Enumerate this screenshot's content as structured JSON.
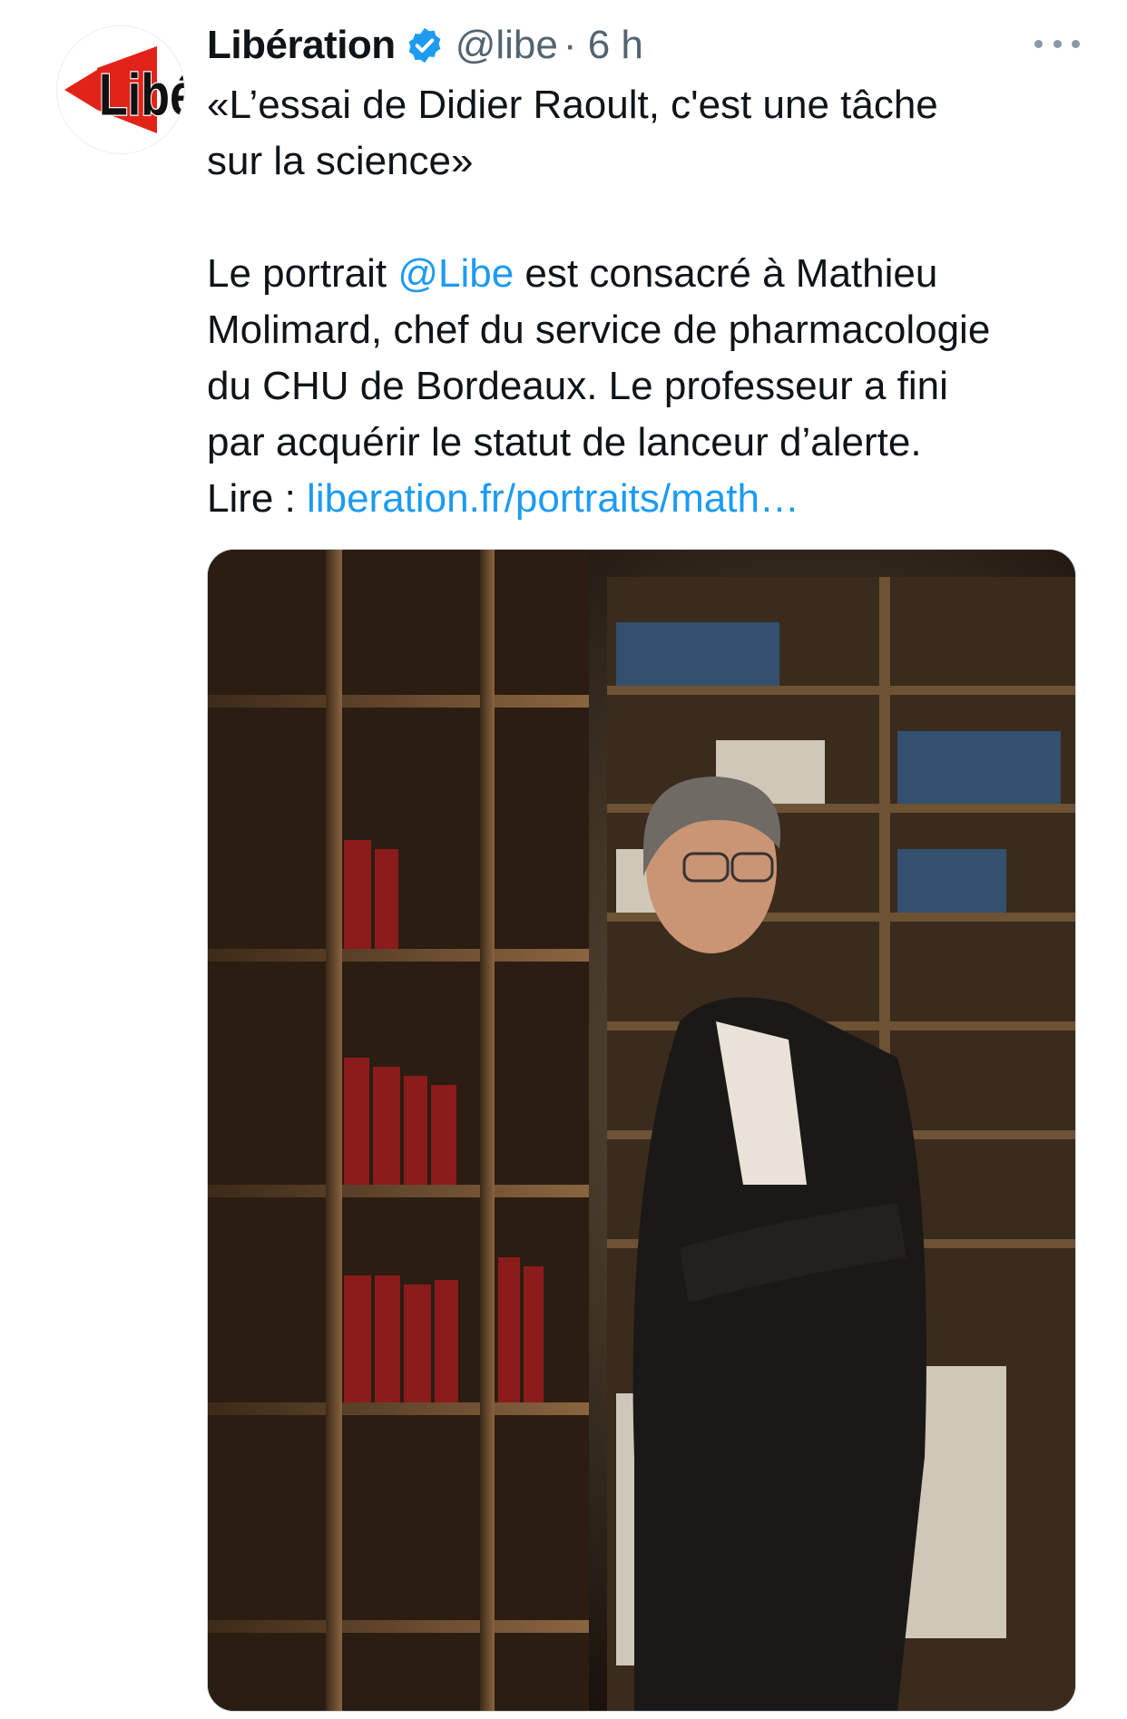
{
  "tweet": {
    "author": {
      "name": "Libération",
      "handle": "@libe",
      "time": "· 6 h",
      "avatar_text": "Libé",
      "verified": true
    },
    "more_icon": "more-icon",
    "lines": {
      "quote_line1": "«L’essai de Didier Raoult, c'est une tâche",
      "quote_line2": "sur la science»",
      "para_prefix": "Le portrait ",
      "mention": "@Libe",
      "para_after_mention": " est consacré à Mathieu",
      "para_line2": "Molimard, chef du service de pharmacologie",
      "para_line3": "du CHU de Bordeaux. Le professeur a fini",
      "para_line4": "par acquérir le statut de lanceur d’alerte.",
      "read_prefix": "Lire : ",
      "read_link": "liberation.fr/portraits/math…"
    },
    "media": {
      "subject": "portrait-photo"
    }
  },
  "colors": {
    "link": "#1d9bf0",
    "secondary": "#536471",
    "verified": "#1d9bf0",
    "brand_red": "#e2231a"
  }
}
